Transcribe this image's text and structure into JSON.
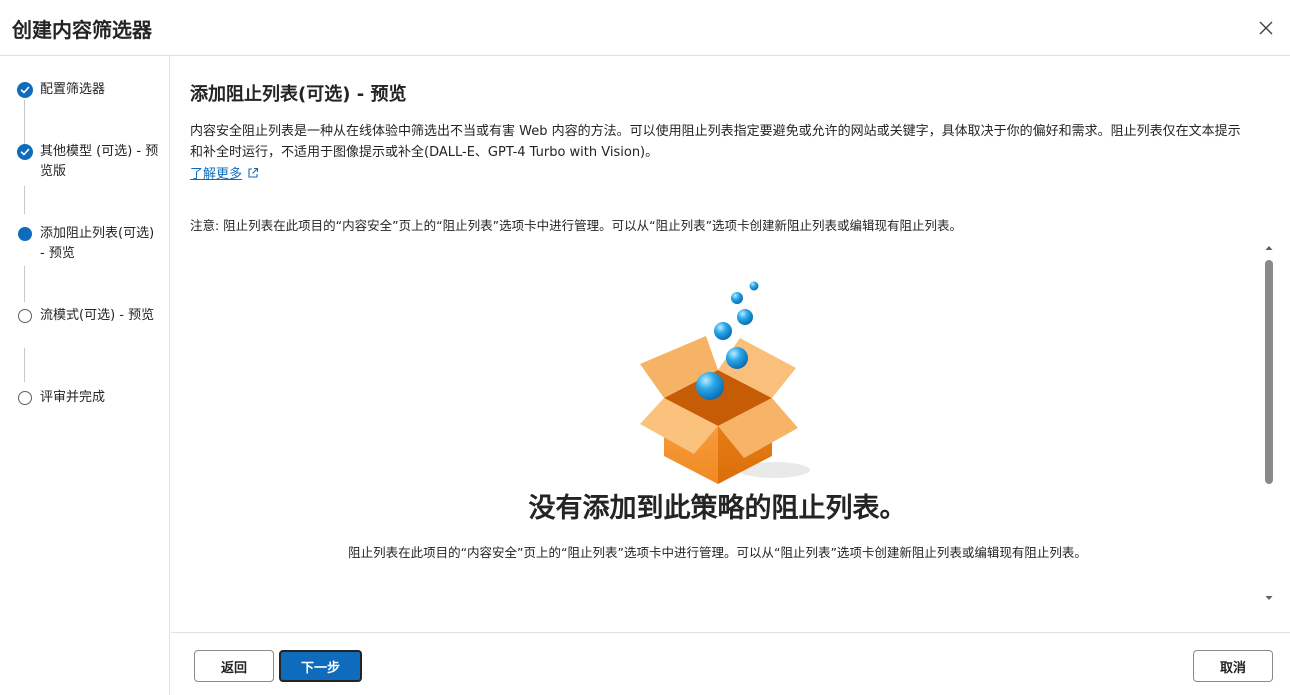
{
  "dialog": {
    "title": "创建内容筛选器",
    "close_icon": "close-icon"
  },
  "steps": [
    {
      "label": "配置筛选器",
      "state": "done"
    },
    {
      "label": "其他模型 (可选) - 预览版",
      "state": "done"
    },
    {
      "label": "添加阻止列表(可选) - 预览",
      "state": "current"
    },
    {
      "label": "流模式(可选) - 预览",
      "state": "empty"
    },
    {
      "label": "评审并完成",
      "state": "empty"
    }
  ],
  "main": {
    "title": "添加阻止列表(可选) - 预览",
    "description": "内容安全阻止列表是一种从在线体验中筛选出不当或有害 Web 内容的方法。可以使用阻止列表指定要避免或允许的网站或关键字，具体取决于你的偏好和需求。阻止列表仅在文本提示和补全时运行，不适用于图像提示或补全(DALL-E、GPT-4 Turbo with Vision)。",
    "learn_more": "了解更多",
    "note": "注意: 阻止列表在此项目的“内容安全”页上的“阻止列表”选项卡中进行管理。可以从“阻止列表”选项卡创建新阻止列表或编辑现有阻止列表。",
    "empty_state": {
      "title": "没有添加到此策略的阻止列表。",
      "description": "阻止列表在此项目的“内容安全”页上的“阻止列表”选项卡中进行管理。可以从“阻止列表”选项卡创建新阻止列表或编辑现有阻止列表。"
    }
  },
  "footer": {
    "back": "返回",
    "next": "下一步",
    "cancel": "取消"
  },
  "colors": {
    "accent": "#0f6cbd",
    "box_orange": "#f5a04a",
    "bubble_blue": "#1e9be0"
  }
}
